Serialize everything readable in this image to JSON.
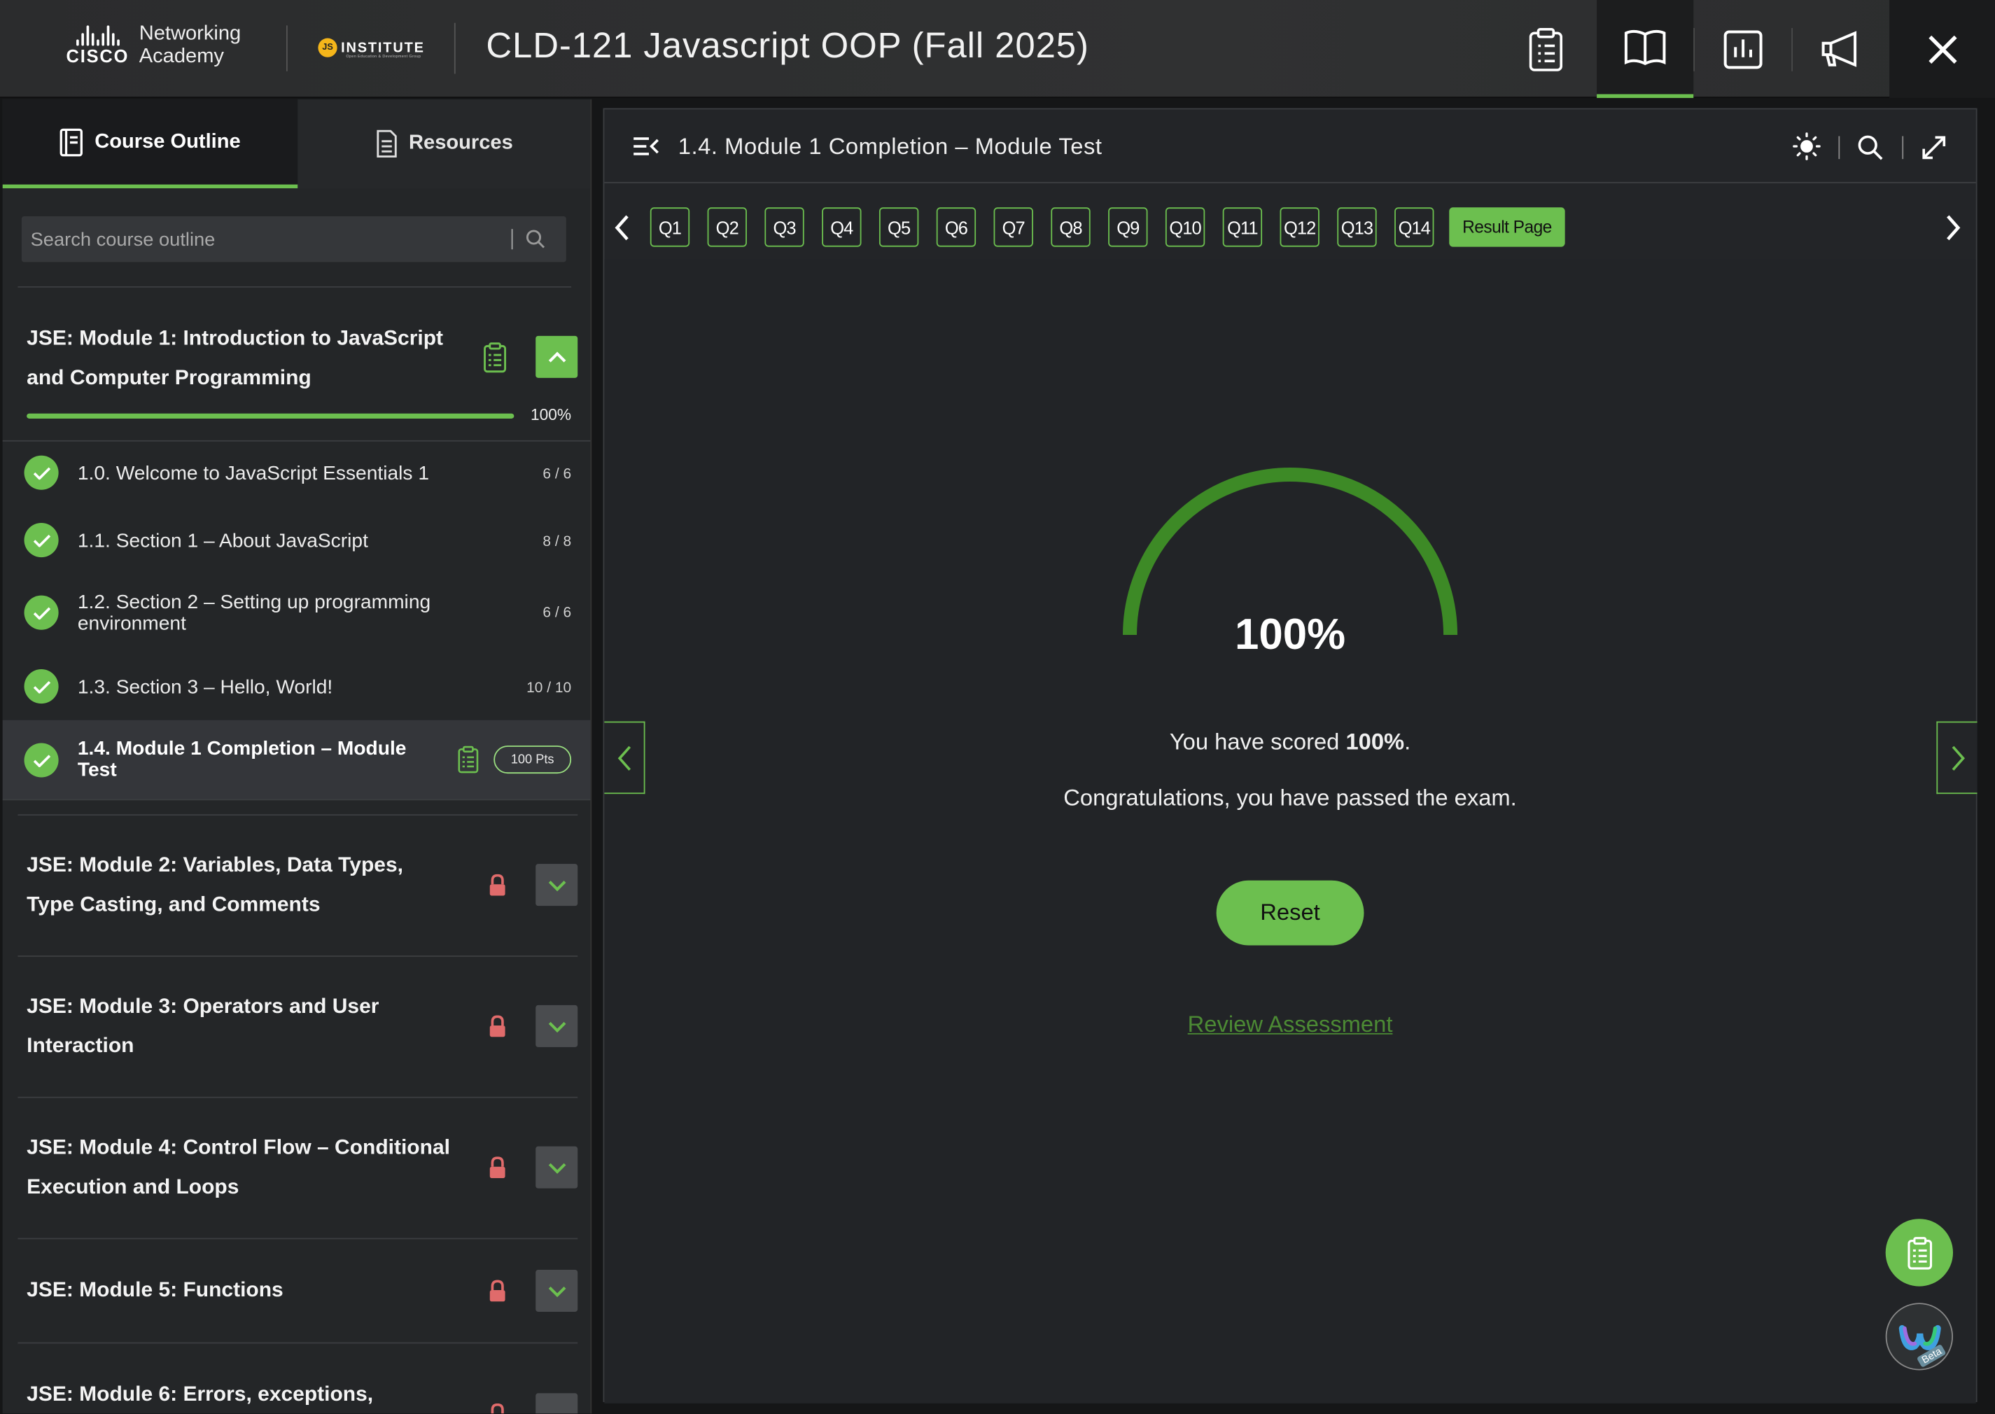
{
  "header": {
    "cisco_word": "CISCO",
    "networking": "Networking",
    "academy": "Academy",
    "js_badge": "JS",
    "js_institute": "INSTITUTE",
    "js_sub": "Open Education & Development Group",
    "course_title": "CLD-121 Javascript OOP (Fall 2025)",
    "icons": [
      "clipboard-icon",
      "book-icon",
      "chart-icon",
      "megaphone-icon",
      "close-icon"
    ],
    "active_icon": "book-icon"
  },
  "sidebar": {
    "tabs": [
      {
        "label": "Course Outline",
        "icon": "outline-icon",
        "active": true
      },
      {
        "label": "Resources",
        "icon": "document-icon",
        "active": false
      }
    ],
    "search": {
      "placeholder": "Search course outline",
      "value": ""
    },
    "module1": {
      "title_line1": "JSE: Module 1: Introduction to JavaScript",
      "title_line2": "and Computer Programming",
      "progress_percent": 100,
      "progress_label": "100%",
      "lessons": [
        {
          "title": "1.0. Welcome to JavaScript Essentials 1",
          "count": "6 / 6"
        },
        {
          "title": "1.1. Section 1 – About JavaScript",
          "count": "8 / 8"
        },
        {
          "title_line1": "1.2. Section 2 – Setting up programming",
          "title_line2": "environment",
          "count": "6 / 6"
        },
        {
          "title": "1.3. Section 3 – Hello, World!",
          "count": "10 / 10"
        },
        {
          "title_line1": "1.4. Module 1 Completion – Module",
          "title_line2": "Test",
          "points": "100 Pts"
        }
      ]
    },
    "locked_modules": [
      {
        "line1": "JSE: Module 2: Variables, Data Types,",
        "line2": "Type Casting, and Comments"
      },
      {
        "line1": "JSE: Module 3: Operators and User",
        "line2": "Interaction"
      },
      {
        "line1": "JSE: Module 4: Control Flow – Conditional",
        "line2": "Execution and Loops"
      },
      {
        "line1": "JSE: Module 5: Functions",
        "line2": ""
      },
      {
        "line1": "JSE: Module 6: Errors, exceptions,",
        "line2": ""
      }
    ]
  },
  "main": {
    "panel_title": "1.4. Module 1 Completion – Module Test",
    "questions": [
      "Q1",
      "Q2",
      "Q3",
      "Q4",
      "Q5",
      "Q6",
      "Q7",
      "Q8",
      "Q9",
      "Q10",
      "Q11",
      "Q12",
      "Q13",
      "Q14"
    ],
    "result_page_label": "Result Page",
    "score_percent": 100,
    "score_label": "100%",
    "scored_prefix": "You have scored ",
    "scored_value": "100%",
    "scored_suffix": ".",
    "congrats": "Congratulations, you have passed the exam.",
    "reset_label": "Reset",
    "review_label": "Review Assessment",
    "accent_color": "#6cbf4f",
    "gauge_color": "#3d8a26"
  },
  "fab": {
    "beta_label": "Beta"
  }
}
